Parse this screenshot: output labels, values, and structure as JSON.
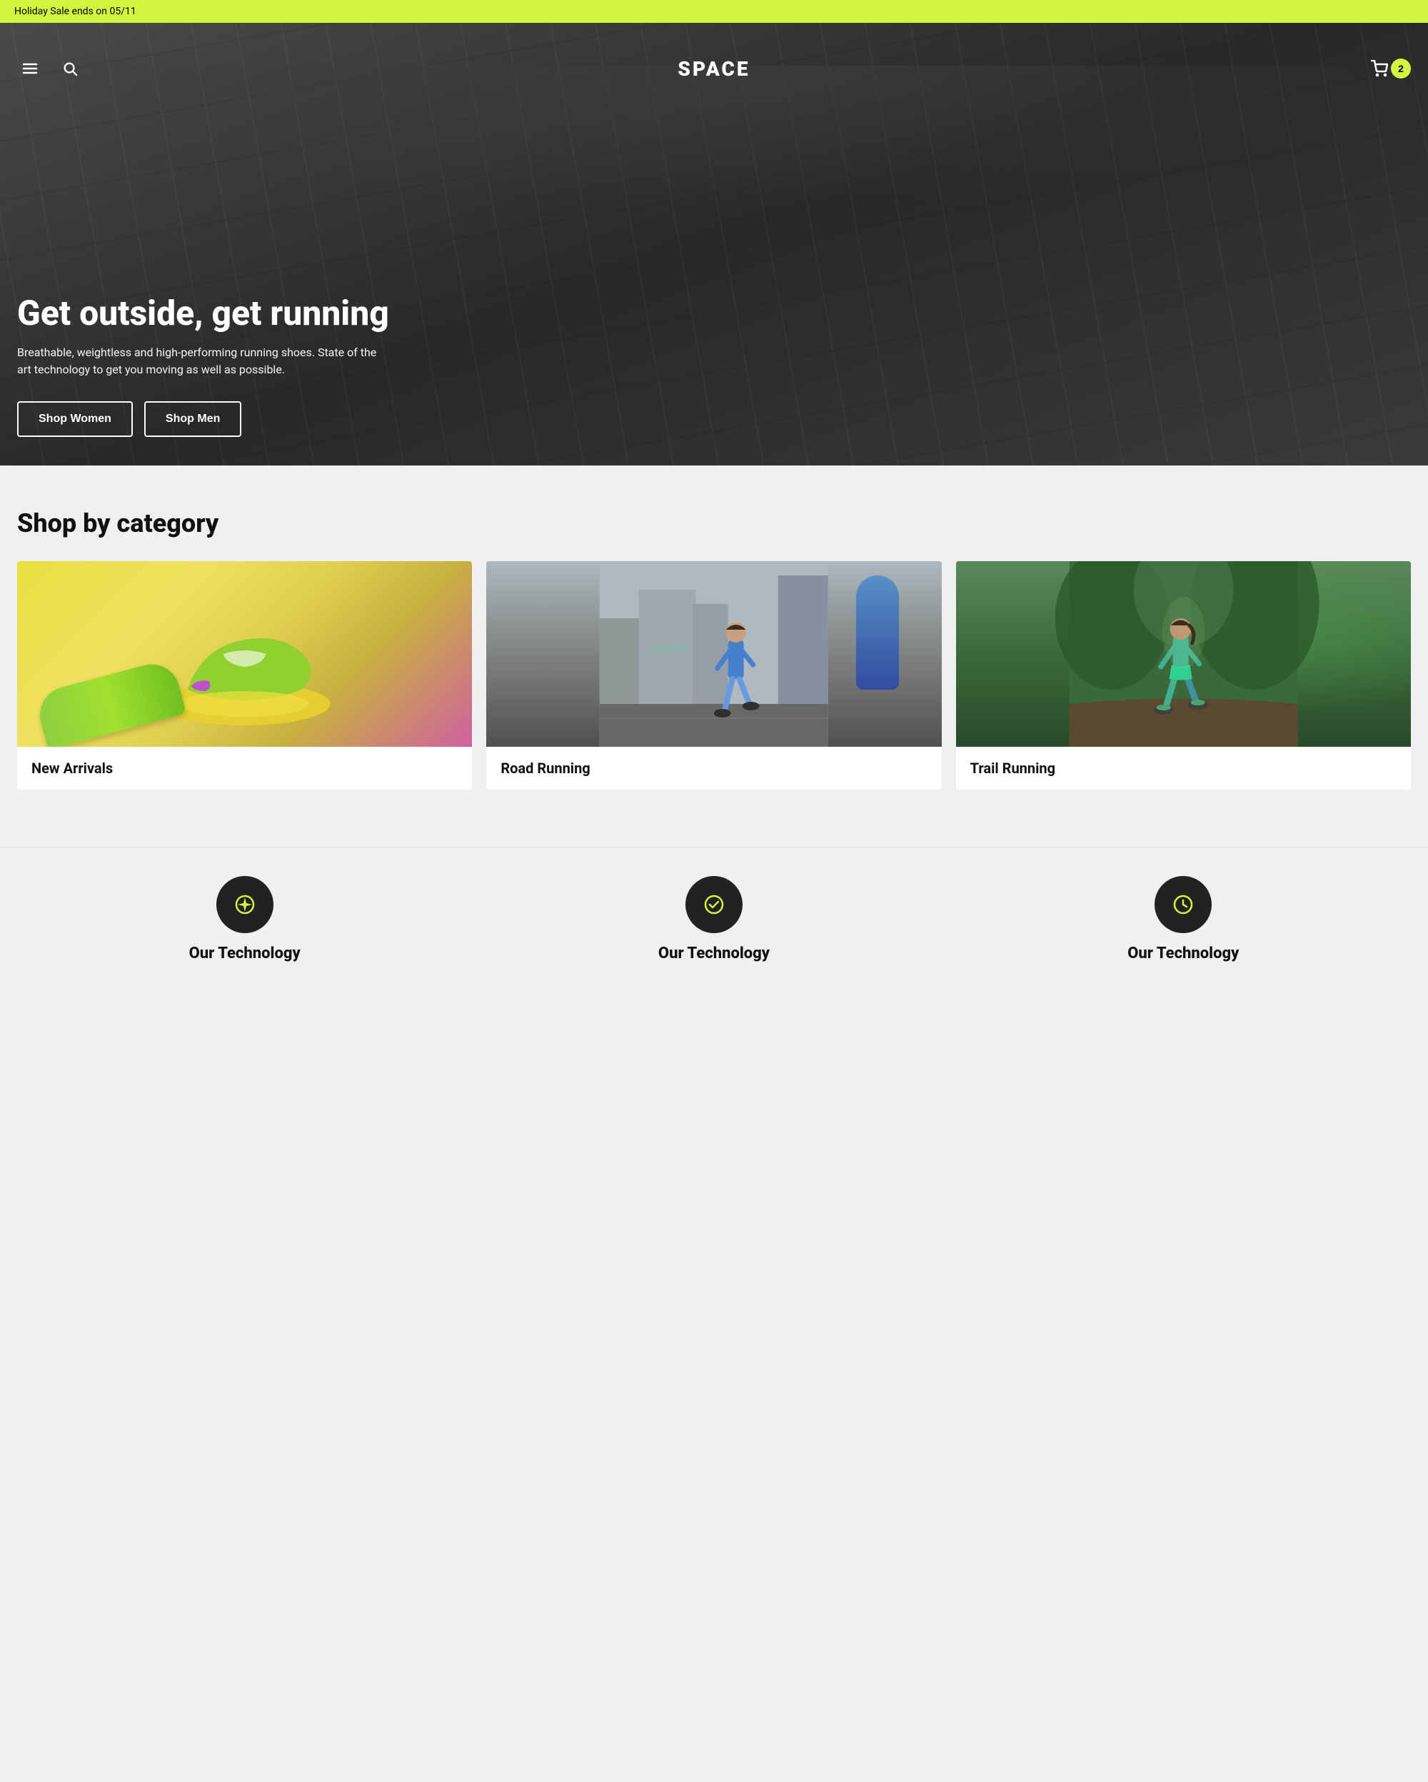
{
  "announcement": {
    "text": "Holiday Sale ends on 05/11"
  },
  "header": {
    "logo": "SPACE",
    "menu_label": "Menu",
    "search_label": "Search",
    "cart_label": "Cart",
    "cart_count": "2"
  },
  "hero": {
    "title": "Get outside, get running",
    "subtitle": "Breathable, weightless and high-performing running shoes. State of the art technology to get you moving as well as possible.",
    "button_women": "Shop Women",
    "button_men": "Shop Men"
  },
  "categories": {
    "section_title": "Shop by category",
    "items": [
      {
        "id": "new-arrivals",
        "label": "New Arrivals"
      },
      {
        "id": "road-running",
        "label": "Road Running"
      },
      {
        "id": "trail-running",
        "label": "Trail Running"
      }
    ]
  },
  "technology": {
    "section_title": "Our Technology"
  }
}
